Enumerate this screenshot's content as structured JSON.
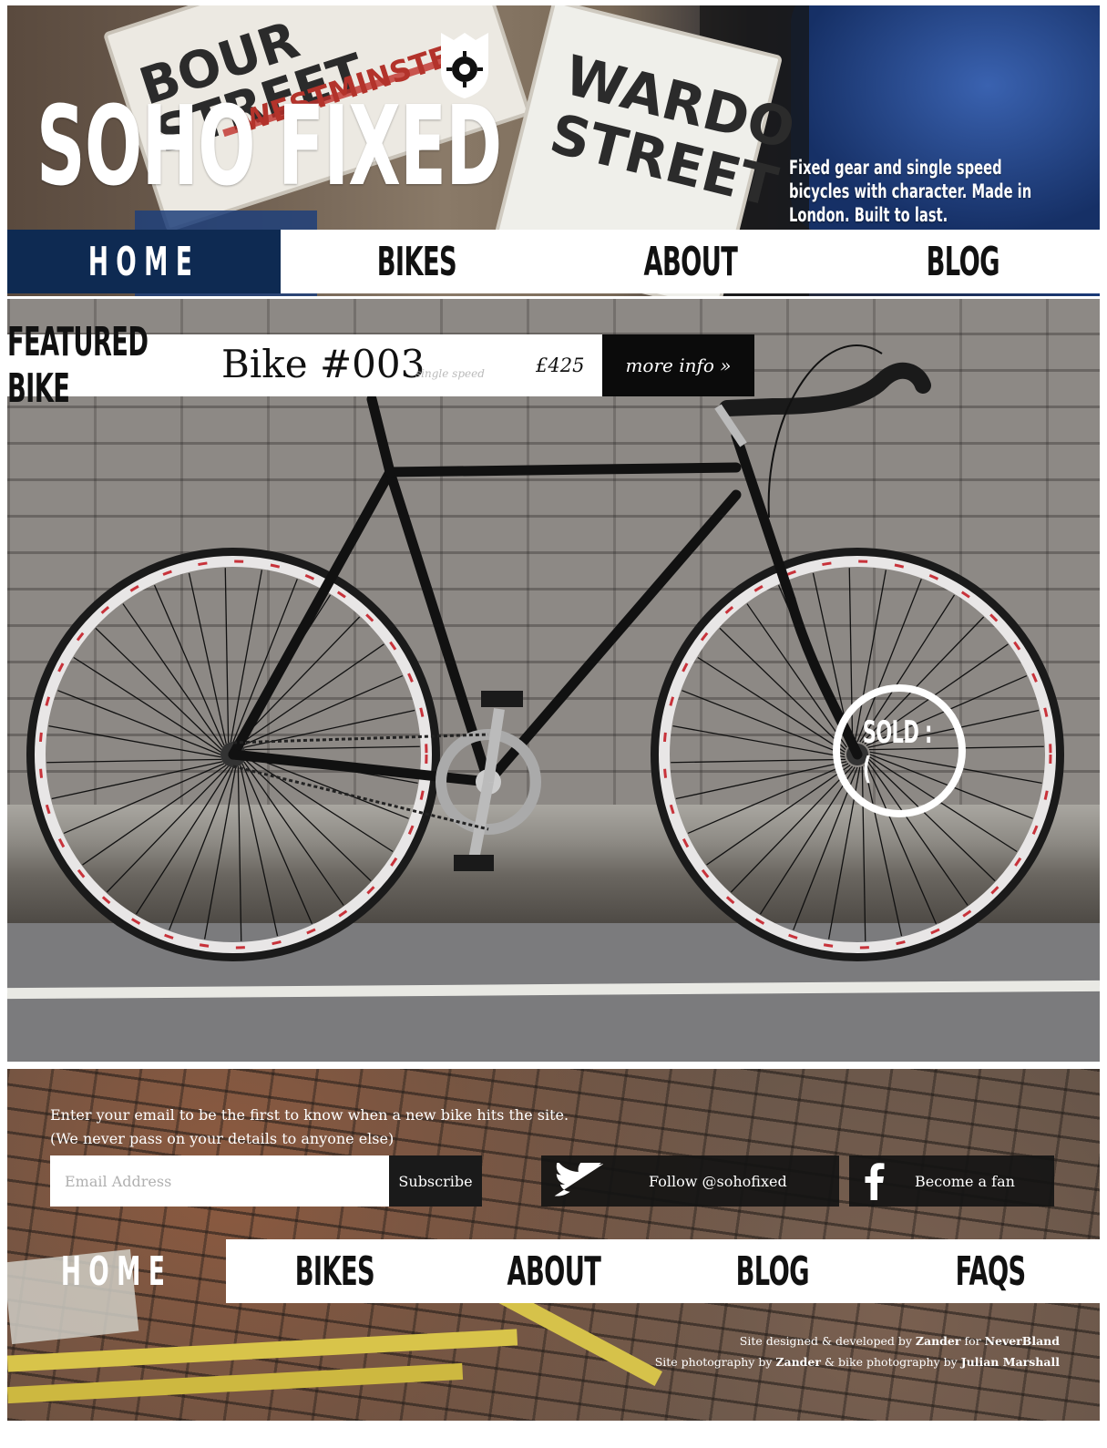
{
  "header": {
    "title": "SOHO FIXED",
    "tagline": "Fixed gear and single speed bicycles with character. Made in London. Built to last.",
    "photo_signs": [
      "BOUR STREET",
      "WESTMINSTER",
      "WARDO STREET"
    ]
  },
  "nav": {
    "items": [
      {
        "label": "HOME",
        "active": true
      },
      {
        "label": "BIKES",
        "active": false
      },
      {
        "label": "ABOUT",
        "active": false
      },
      {
        "label": "BLOG",
        "active": false
      }
    ]
  },
  "featured": {
    "label": "FEATURED BIKE",
    "name": "Bike #003",
    "type": "single speed",
    "price": "£425",
    "more_info": "more info »",
    "status": "SOLD :("
  },
  "signup": {
    "line1": "Enter your email to be the first to know when a new bike hits the site.",
    "line2": "(We never pass on your details to anyone else)",
    "email_placeholder": "Email Address",
    "subscribe_label": "Subscribe",
    "twitter_label": "Follow @sohofixed",
    "facebook_label": "Become a fan"
  },
  "footer_nav": {
    "items": [
      {
        "label": "HOME",
        "active": true
      },
      {
        "label": "BIKES",
        "active": false
      },
      {
        "label": "ABOUT",
        "active": false
      },
      {
        "label": "BLOG",
        "active": false
      },
      {
        "label": "FAQS",
        "active": false
      }
    ]
  },
  "credits": {
    "line1_prefix": "Site designed & developed by",
    "line1_name": "Zander",
    "line1_mid": "for",
    "line1_company": "NeverBland",
    "line2_prefix": "Site photography by",
    "line2_name": "Zander",
    "line2_mid": "& bike photography by",
    "line2_photographer": "Julian Marshall"
  },
  "colors": {
    "nav_active": "#0e2a52",
    "button_dark": "#0b0b0b",
    "text_light": "#ffffff"
  }
}
